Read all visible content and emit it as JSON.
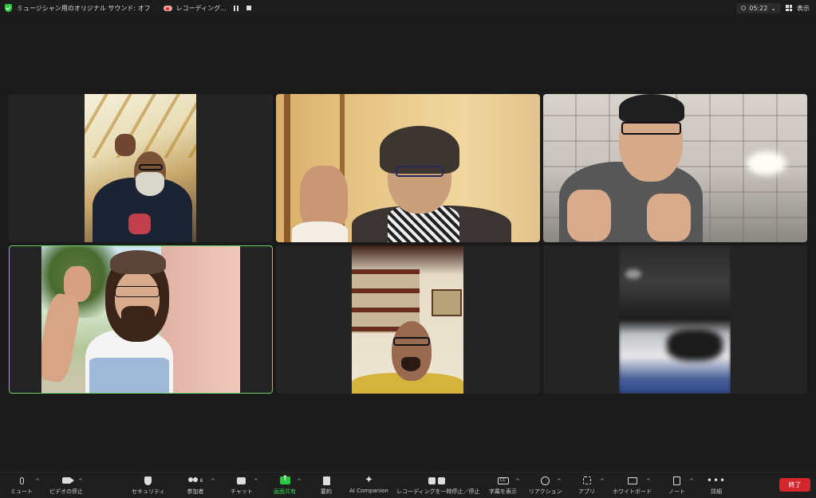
{
  "topbar": {
    "music_mode": "ミュージシャン用のオリジナル サウンド: オフ",
    "recording": "レコーディング...",
    "timer": "05:22",
    "view": "表示"
  },
  "toolbar": {
    "mute": "ミュート",
    "video_stop": "ビデオの停止",
    "security": "セキュリティ",
    "participants": "参加者",
    "participant_count": "6",
    "chat": "チャット",
    "share_screen": "画面共有",
    "summary": "要約",
    "ai_companion": "AI Companion",
    "recording_pause_stop": "レコーディングを一時停止／停止",
    "show_captions": "字幕を表示",
    "reactions": "リアクション",
    "apps": "アプリ",
    "whiteboard": "ホワイトボード",
    "notes": "ノート",
    "more": "詳細",
    "end": "終了",
    "cc_text": "CC"
  },
  "colors": {
    "active_speaker_border": "#6dd36d",
    "share_green": "#28c840",
    "end_red": "#d5262b"
  }
}
